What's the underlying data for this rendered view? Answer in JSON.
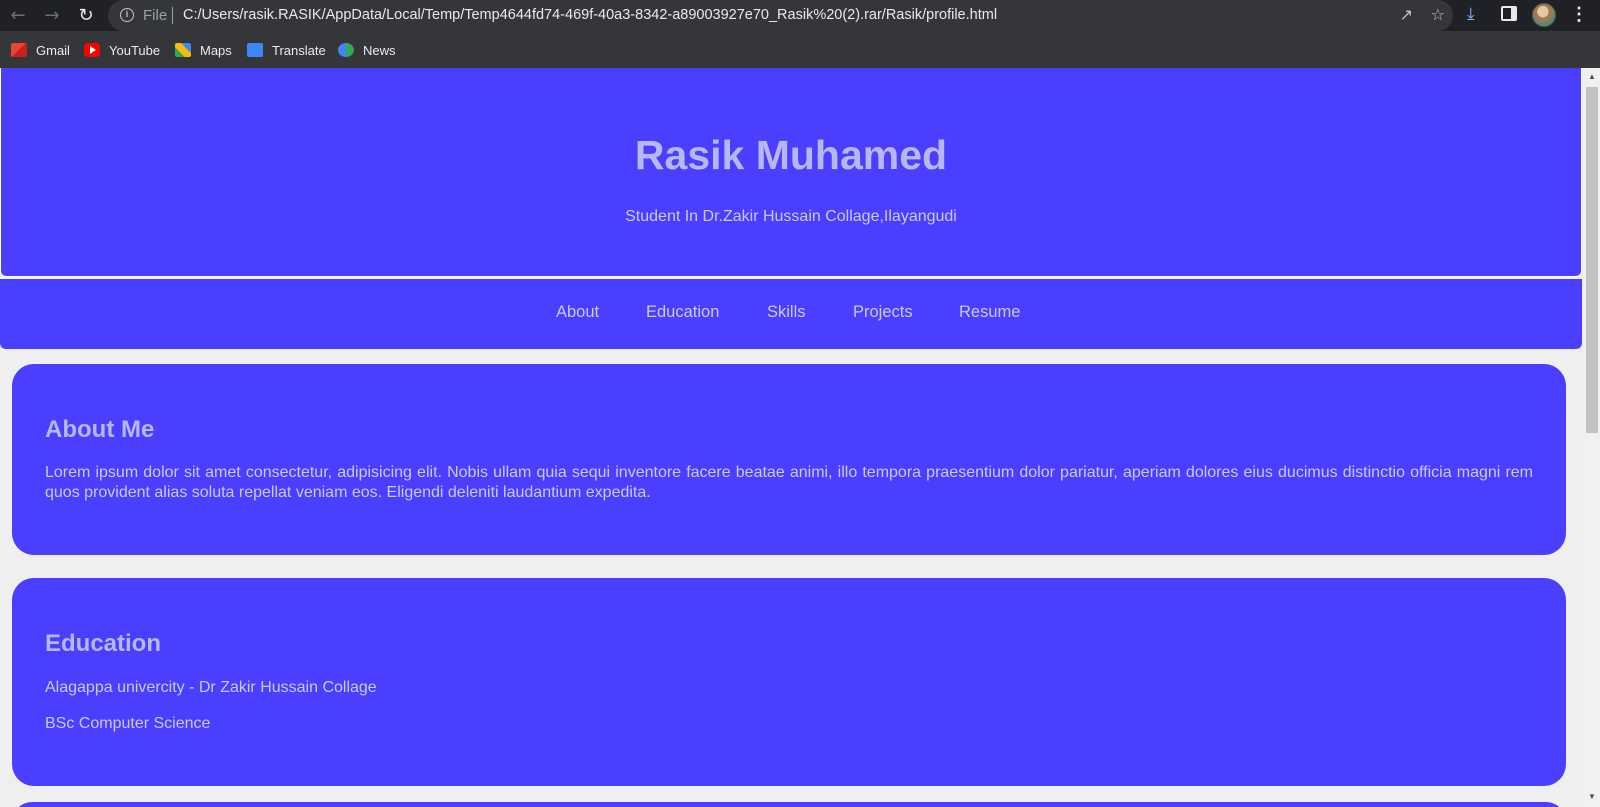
{
  "browser": {
    "file_label": "File",
    "url": "C:/Users/rasik.RASIK/AppData/Local/Temp/Temp4644fd74-469f-40a3-8342-a89003927e70_Rasik%20(2).rar/Rasik/profile.html",
    "bookmarks": [
      {
        "label": "Gmail",
        "icon": "gmail-icon"
      },
      {
        "label": "YouTube",
        "icon": "youtube-icon"
      },
      {
        "label": "Maps",
        "icon": "maps-icon"
      },
      {
        "label": "Translate",
        "icon": "translate-icon"
      },
      {
        "label": "News",
        "icon": "news-icon"
      }
    ]
  },
  "hero": {
    "name": "Rasik Muhamed",
    "subtitle": "Student In Dr.Zakir Hussain Collage,Ilayangudi"
  },
  "nav": {
    "links": [
      "About",
      "Education",
      "Skills",
      "Projects",
      "Resume"
    ]
  },
  "about": {
    "title": "About Me",
    "text": "Lorem ipsum dolor sit amet consectetur, adipisicing elit. Nobis ullam quia sequi inventore facere beatae animi, illo tempora praesentium dolor pariatur, aperiam dolores eius ducimus distinctio officia magni rem quos provident alias soluta repellat veniam eos. Eligendi deleniti laudantium expedita."
  },
  "education": {
    "title": "Education",
    "lines": [
      "Alagappa univercity - Dr Zakir Hussain Collage",
      "BSc Computer Science"
    ]
  },
  "colors": {
    "accent": "#4a3ffe",
    "heading_text": "#b7b7f5",
    "body_text": "#c9c9f8",
    "page_background": "#efefef"
  }
}
